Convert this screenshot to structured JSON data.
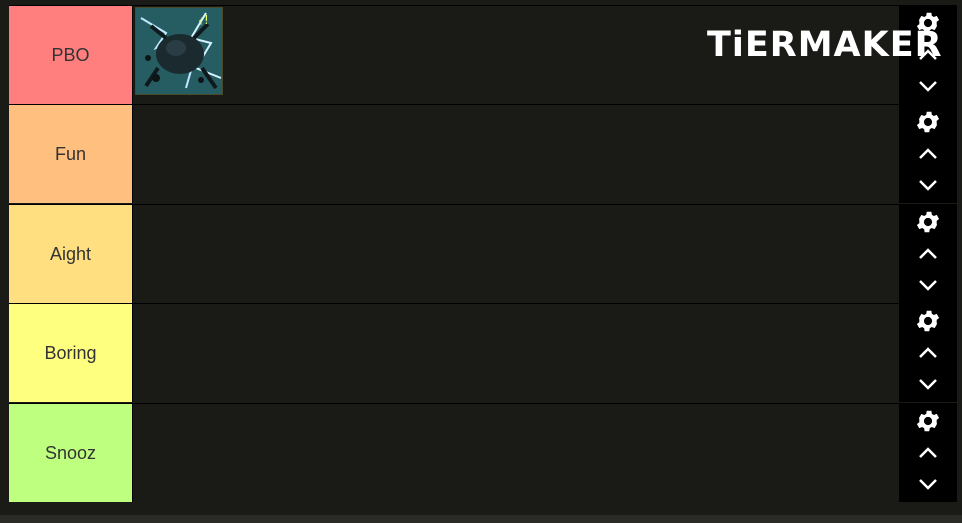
{
  "logo": {
    "text": "TiERMAKER",
    "grid_colors": [
      "#ff7f7f",
      "#ffbf7f",
      "#ffdf7f",
      "#3a3a3a",
      "#ff7f7f",
      "#ffbf7f",
      "#ffdf7f",
      "#ffff7f",
      "#ffdf7f",
      "#ffff7f",
      "#3a3a3a",
      "#3a3a3a",
      "#bfff7f",
      "#7fff7f",
      "#7fff7f",
      "#3a3a3a"
    ]
  },
  "tiers": [
    {
      "label": "PBO",
      "color": "#ff7f7f",
      "items": [
        {
          "name": "card-art-thumbnail"
        }
      ]
    },
    {
      "label": "Fun",
      "color": "#ffbf7f",
      "items": []
    },
    {
      "label": "Aight",
      "color": "#ffdf7f",
      "items": []
    },
    {
      "label": "Boring",
      "color": "#ffff7f",
      "items": []
    },
    {
      "label": "Snooz",
      "color": "#bfff7f",
      "items": []
    }
  ],
  "controls": {
    "settings_icon": "gear-icon",
    "up_icon": "chevron-up-icon",
    "down_icon": "chevron-down-icon"
  }
}
